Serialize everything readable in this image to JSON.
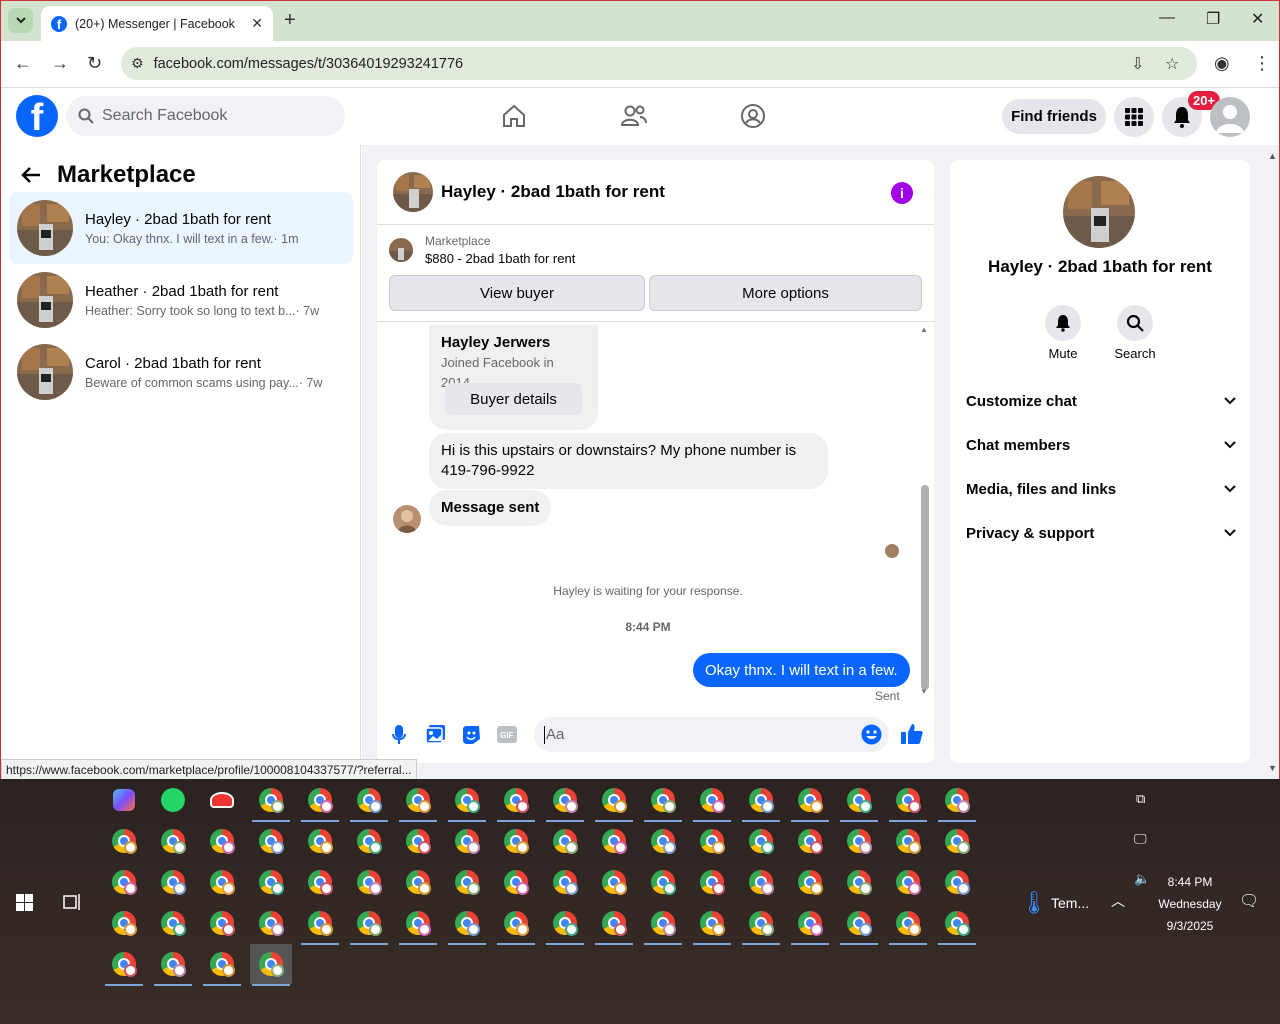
{
  "browser": {
    "tab_title": "(20+) Messenger | Facebook",
    "url": "facebook.com/messages/t/30364019293241776",
    "status_url": "https://www.facebook.com/marketplace/profile/100008104337577/?referral..."
  },
  "fb": {
    "search_placeholder": "Search Facebook",
    "find_friends": "Find friends",
    "notif_badge": "20+"
  },
  "left": {
    "title": "Marketplace",
    "conversations": [
      {
        "name": "Hayley · 2bad 1bath for rent",
        "preview": "You: Okay thnx. I will text in a few.",
        "time": "· 1m"
      },
      {
        "name": "Heather · 2bad 1bath for rent",
        "preview": "Heather: Sorry took so long to text b...",
        "time": "· 7w"
      },
      {
        "name": "Carol · 2bad 1bath for rent",
        "preview": "Beware of common scams using pay...",
        "time": "· 7w"
      }
    ]
  },
  "chat": {
    "title": "Hayley · 2bad 1bath for rent",
    "listing_label": "Marketplace",
    "listing_title": "$880 - 2bad 1bath for rent",
    "view_buyer": "View buyer",
    "more_options": "More options",
    "buyer_name": "Hayley Jerwers",
    "buyer_joined": "Joined Facebook in 2014",
    "buyer_details": "Buyer details",
    "msg1": "Hi is this upstairs or downstairs? My phone number is 419-796-9922",
    "msg2": "Message sent",
    "waiting": "Hayley is waiting for your response.",
    "timestamp": "8:44 PM",
    "out_msg": "Okay thnx. I will text in a few.",
    "sent": "Sent",
    "input_placeholder": "Aa"
  },
  "right": {
    "name": "Hayley · 2bad 1bath for rent",
    "mute": "Mute",
    "search": "Search",
    "sections": [
      "Customize chat",
      "Chat members",
      "Media, files and links",
      "Privacy & support"
    ]
  },
  "taskbar": {
    "weather": "Tem...",
    "time": "8:44 PM",
    "day": "Wednesday",
    "date": "9/3/2025"
  },
  "colors": {
    "fb_blue": "#0866ff",
    "info_purple": "#a200e8",
    "badge_red": "#e41e3f"
  }
}
